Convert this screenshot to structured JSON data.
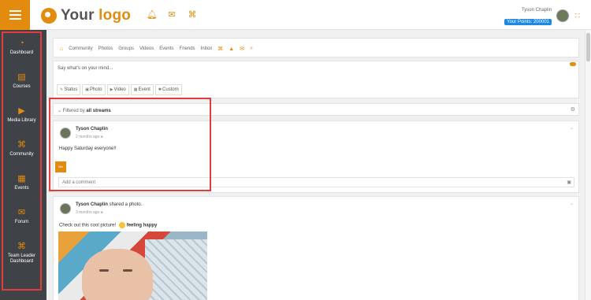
{
  "topbar": {
    "logo_word1": "Your",
    "logo_word2": "logo",
    "user_name": "Tyson Chaplin",
    "points": "Your Points: 200001"
  },
  "sidebar": {
    "items": [
      {
        "label": "Dashboard",
        "icon": "dashboard-icon"
      },
      {
        "label": "Courses",
        "icon": "book-icon"
      },
      {
        "label": "Media Library",
        "icon": "media-icon"
      },
      {
        "label": "Community",
        "icon": "community-icon"
      },
      {
        "label": "Events",
        "icon": "calendar-icon"
      },
      {
        "label": "Forum",
        "icon": "forum-icon"
      },
      {
        "label": "Team Leader Dashboard",
        "icon": "team-icon"
      }
    ]
  },
  "nav": {
    "items": [
      "Community",
      "Photos",
      "Groups",
      "Videos",
      "Events",
      "Friends",
      "Inbox"
    ]
  },
  "composer": {
    "placeholder": "Say what's on your mind...",
    "tabs": [
      "Status",
      "Photo",
      "Video",
      "Event",
      "Custom"
    ]
  },
  "filter": {
    "prefix": "Filtered by",
    "value": "all streams"
  },
  "posts": [
    {
      "author": "Tyson Chaplin",
      "action": "",
      "time": "2 months ago",
      "text": "Happy Saturday everyone!!",
      "like_label": "like",
      "comment_placeholder": "Add a comment"
    },
    {
      "author": "Tyson Chaplin",
      "action": "shared a photo.",
      "time": "3 months ago",
      "text": "Check out this cool picture!",
      "feeling": "feeling happy"
    }
  ],
  "colors": {
    "accent": "#e38b0e",
    "sidebar": "#3f4347",
    "highlight": "#e23c3c",
    "points_badge": "#1e88e5"
  }
}
